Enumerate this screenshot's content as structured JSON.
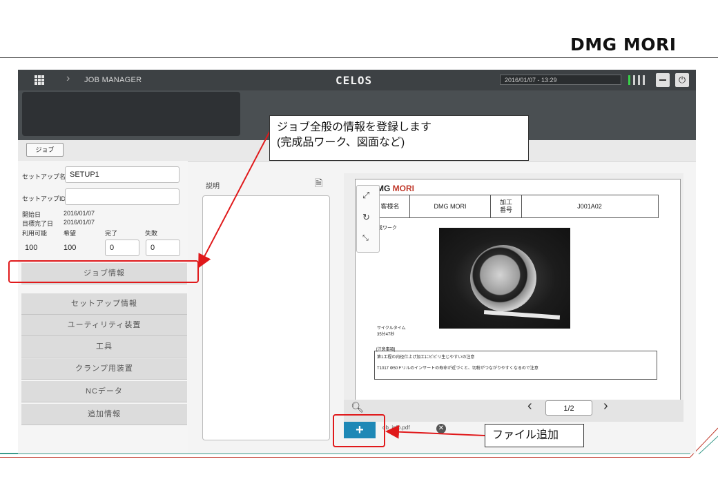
{
  "brand": "DMG MORI",
  "app": {
    "breadcrumb": "JOB MANAGER",
    "logo": "CELOS",
    "datetime": "2016/01/07 - 13:29",
    "power_glyph": "⏻",
    "back_tab": "ジョブ",
    "signal_colors": [
      "#39d24a",
      "#d0d0d0",
      "#d0d0d0",
      "#d0d0d0"
    ]
  },
  "form": {
    "setup_name_label": "セットアップ名",
    "setup_name_value": "SETUP1",
    "setup_id_label": "セットアップID",
    "setup_id_value": "",
    "start_date_label": "開始日",
    "start_date_value": "2016/01/07",
    "target_date_label": "目標完了日",
    "target_date_value": "2016/01/07",
    "available_label": "利用可能",
    "desired_label": "希望",
    "done_label": "完了",
    "failed_label": "失敗",
    "available_value": "100",
    "desired_value": "100",
    "done_value": "0",
    "failed_value": "0"
  },
  "nav": [
    {
      "label": "ジョブ情報"
    },
    {
      "label": "セットアップ情報"
    },
    {
      "label": "ユーティリティ装置"
    },
    {
      "label": "工具"
    },
    {
      "label": "クランプ用装置"
    },
    {
      "label": "NCデータ"
    },
    {
      "label": "追加情報"
    }
  ],
  "description": {
    "label": "説明",
    "value": ""
  },
  "preview": {
    "doc_brand_a": "MG ",
    "doc_brand_b": "MORI",
    "customer_label": "客様名",
    "customer_value": "DMG MORI",
    "process_label": "加工\n番号",
    "process_value": "J001A02",
    "finished_label": "完成ワーク",
    "cycle_label": "サイクルタイム",
    "cycle_value": "35分47秒",
    "notes_label": "[注意事項]",
    "note_1": "第1工程の内径仕上げ加工にビビリ生じやすいの注意",
    "note_2": "T1017 Φ50ドリルのインサートの寿命が近づくと、切粉がつながりやすくなるので注意",
    "page": "1/2",
    "attachment": "ob_info.pdf"
  },
  "callouts": {
    "job_info": "ジョブ全般の情報を登録します\n(完成品ワーク、図面など)",
    "add_file": "ファイル追加"
  }
}
